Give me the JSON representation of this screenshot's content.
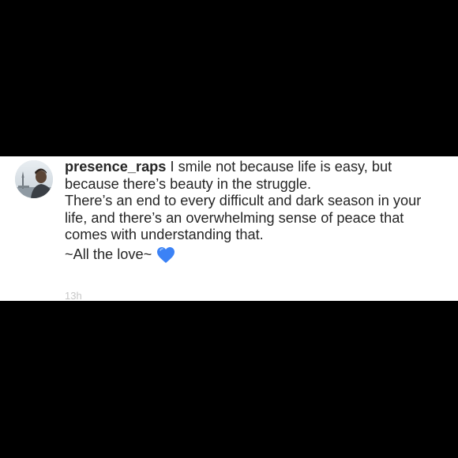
{
  "comment": {
    "username": "presence_raps",
    "text": "I smile not because life is easy, but because there’s beauty in the struggle.\nThere’s an end to every difficult and dark season in your life, and there’s an overwhelming sense of peace that comes with understanding that.",
    "signoff": "~All the love~",
    "emoji": "blue-heart-icon",
    "timestamp": "13h"
  },
  "colors": {
    "background": "#000000",
    "card": "#ffffff",
    "text": "#262626",
    "timestamp": "#c7c7c7",
    "heart": "#3b82f6"
  }
}
